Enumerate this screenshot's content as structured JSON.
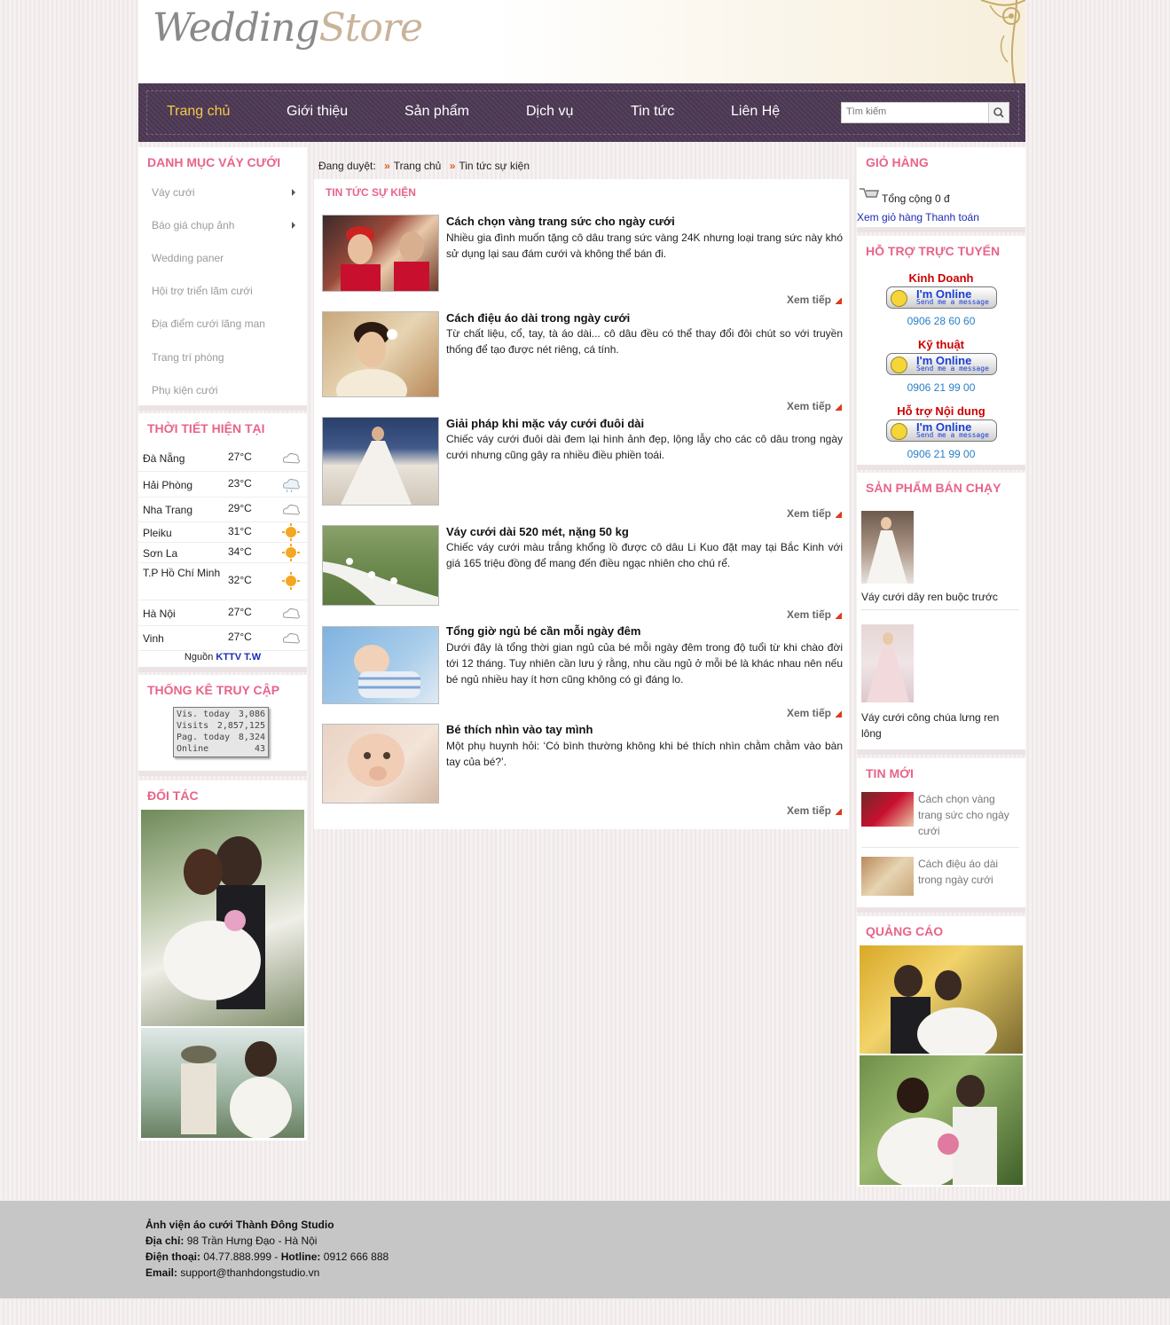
{
  "logo": {
    "part1": "Wedding",
    "part2": "Store"
  },
  "nav": {
    "items": [
      "Trang chủ",
      "Giới thiệu",
      "Sản phẩm",
      "Dịch vụ",
      "Tin tức",
      "Liên Hệ"
    ],
    "search_placeholder": "Tìm kiếm"
  },
  "left": {
    "categories_title": "Danh mục váy cưới",
    "categories": [
      "Váy cưới",
      "Báo giá chụp ảnh",
      "Wedding paner",
      "Hội trợ triển lãm cưới",
      "Địa điểm cưới lãng man",
      "Trang trí phòng",
      "Phụ kiện cưới"
    ],
    "weather_title": "Thời tiết hiện tại",
    "weather": [
      {
        "city": "Đà Nẵng",
        "temp": "27°C",
        "icon": "cloud-icon"
      },
      {
        "city": "Hải Phòng",
        "temp": "23°C",
        "icon": "rain-cloud-icon"
      },
      {
        "city": "Nha Trang",
        "temp": "29°C",
        "icon": "cloud-icon"
      },
      {
        "city": "Pleiku",
        "temp": "31°C",
        "icon": "sun-icon"
      },
      {
        "city": "Sơn La",
        "temp": "34°C",
        "icon": "sun-icon"
      },
      {
        "city": "T.P Hồ Chí Minh",
        "temp": "32°C",
        "icon": "sun-icon"
      },
      {
        "city": "Hà Nội",
        "temp": "27°C",
        "icon": "cloud-icon"
      },
      {
        "city": "Vinh",
        "temp": "27°C",
        "icon": "cloud-icon"
      }
    ],
    "weather_source_label": "Nguồn",
    "weather_source_link": "KTTV T.W",
    "stats_title": "Thống kê truy cập",
    "stats": [
      {
        "label": "Vis. today",
        "value": "3,086"
      },
      {
        "label": "Visits",
        "value": "2,857,125"
      },
      {
        "label": "Pag. today",
        "value": "8,324"
      },
      {
        "label": "Online",
        "value": "43"
      }
    ],
    "partners_title": "Đối tác"
  },
  "breadcrumb": {
    "label": "Đang duyệt:",
    "items": [
      "Trang chủ",
      "Tin tức sự kiện"
    ]
  },
  "main": {
    "title": "Tin tức sự kiện",
    "more_label": "Xem tiếp",
    "news": [
      {
        "title": "Cách chọn vàng trang sức cho ngày cưới",
        "desc": "Nhiều gia đình muốn tặng cô dâu trang sức vàng 24K nhưng loại trang sức này khó sử dụng lại sau đám cưới và không thể bán đi."
      },
      {
        "title": "Cách điệu áo dài trong ngày cưới",
        "desc": "Từ chất liệu, cổ, tay, tà áo dài... cô dâu đều có thể thay đổi đôi chút so với truyền thống để tạo được nét riêng, cá tính."
      },
      {
        "title": "Giải pháp khi mặc váy cưới đuôi dài",
        "desc": "Chiếc váy cưới đuôi dài đem lại hình ảnh đẹp, lộng lẫy cho các cô dâu trong ngày cưới nhưng cũng gây ra nhiều điều phiền toái."
      },
      {
        "title": "Váy cưới dài 520 mét, nặng 50 kg",
        "desc": "Chiếc váy cưới màu trắng khổng lồ được cô dâu Li Kuo đặt may tại Bắc Kinh với giá 165 triệu đồng để mang đến điều ngạc nhiên cho chú rể."
      },
      {
        "title": "Tổng giờ ngủ bé cần mỗi ngày đêm",
        "desc": "Dưới đây là tổng thời gian ngủ của bé mỗi ngày đêm trong độ tuổi từ khi chào đời tới 12 tháng. Tuy nhiên cần lưu ý rằng, nhu cầu ngủ ở mỗi bé là khác nhau nên nếu bé ngủ nhiều hay ít hơn cũng không có gì đáng lo."
      },
      {
        "title": "Bé thích nhìn vào tay mình",
        "desc": "Một phụ huynh hỏi: ‘Có bình thường không khi bé thích nhìn chằm chằm vào bàn tay của bé?’."
      }
    ]
  },
  "right": {
    "cart_title": "Giỏ hàng",
    "cart_total": "Tổng cộng 0 đ",
    "cart_link": "Xem giỏ hàng Thanh toán",
    "support_title": "Hỗ trợ trực tuyến",
    "online_text": "I'm Online",
    "online_sub": "Send me a message",
    "support": [
      {
        "label": "Kinh Doanh",
        "phone": "0906 28 60 60"
      },
      {
        "label": "Kỹ thuật",
        "phone": "0906 21 99 00"
      },
      {
        "label": "Hỗ trợ Nội dung",
        "phone": "0906 21 99 00"
      }
    ],
    "bestseller_title": "Sản phẩm bán chạy",
    "bestsellers": [
      "Váy cưới dây ren buộc trước",
      "Váy cưới công chúa lưng ren lông"
    ],
    "new_title": "Tin mới",
    "new_items": [
      "Cách chọn vàng trang sức cho ngày cưới",
      "Cách điệu áo dài trong ngày cưới"
    ],
    "ads_title": "Quảng cáo"
  },
  "footer": {
    "company": "Ảnh viện áo cưới Thành Đông Studio",
    "address_label": "Địa chỉ:",
    "address": "98 Trần Hưng Đạo - Hà Nội",
    "phone_label": "Điện thoại:",
    "phone": "04.77.888.999",
    "hotline_label": "Hotline:",
    "hotline": "0912 666 888",
    "email_label": "Email:",
    "email": "support@thanhdongstudio.vn"
  }
}
